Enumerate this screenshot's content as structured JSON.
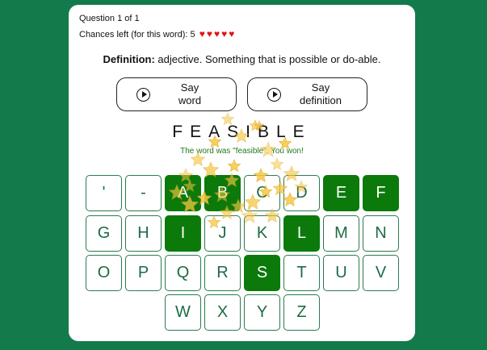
{
  "question": {
    "label": "Question 1 of 1"
  },
  "chances": {
    "label": "Chances left (for this word): 5",
    "hearts": 5
  },
  "definition": {
    "prefix": "Definition:",
    "text": "adjective. Something that is possible or do-able."
  },
  "buttons": {
    "say_word": {
      "label_line1": "Say",
      "label_line2": "word"
    },
    "say_definition": {
      "label_line1": "Say",
      "label_line2": "definition"
    }
  },
  "word_display": "FEASIBLE",
  "result_message": "The word was \"feasible\". You won!",
  "keyboard": {
    "keys": [
      {
        "label": "'",
        "used": false
      },
      {
        "label": "-",
        "used": false
      },
      {
        "label": "A",
        "used": true
      },
      {
        "label": "B",
        "used": true
      },
      {
        "label": "C",
        "used": false
      },
      {
        "label": "D",
        "used": false
      },
      {
        "label": "E",
        "used": true
      },
      {
        "label": "F",
        "used": true
      },
      {
        "label": "G",
        "used": false
      },
      {
        "label": "H",
        "used": false
      },
      {
        "label": "I",
        "used": true
      },
      {
        "label": "J",
        "used": false
      },
      {
        "label": "K",
        "used": false
      },
      {
        "label": "L",
        "used": true
      },
      {
        "label": "M",
        "used": false
      },
      {
        "label": "N",
        "used": false
      },
      {
        "label": "O",
        "used": false
      },
      {
        "label": "P",
        "used": false
      },
      {
        "label": "Q",
        "used": false
      },
      {
        "label": "R",
        "used": false
      },
      {
        "label": "S",
        "used": true
      },
      {
        "label": "T",
        "used": false
      },
      {
        "label": "U",
        "used": false
      },
      {
        "label": "V",
        "used": false
      },
      {
        "label": "W",
        "used": false
      },
      {
        "label": "X",
        "used": false
      },
      {
        "label": "Y",
        "used": false
      },
      {
        "label": "Z",
        "used": false
      }
    ]
  },
  "colors": {
    "background": "#137a4b",
    "used_key": "#0b7a0b",
    "heart": "#e01414",
    "win_text": "#1f7a1f",
    "star": "#f5c842"
  }
}
